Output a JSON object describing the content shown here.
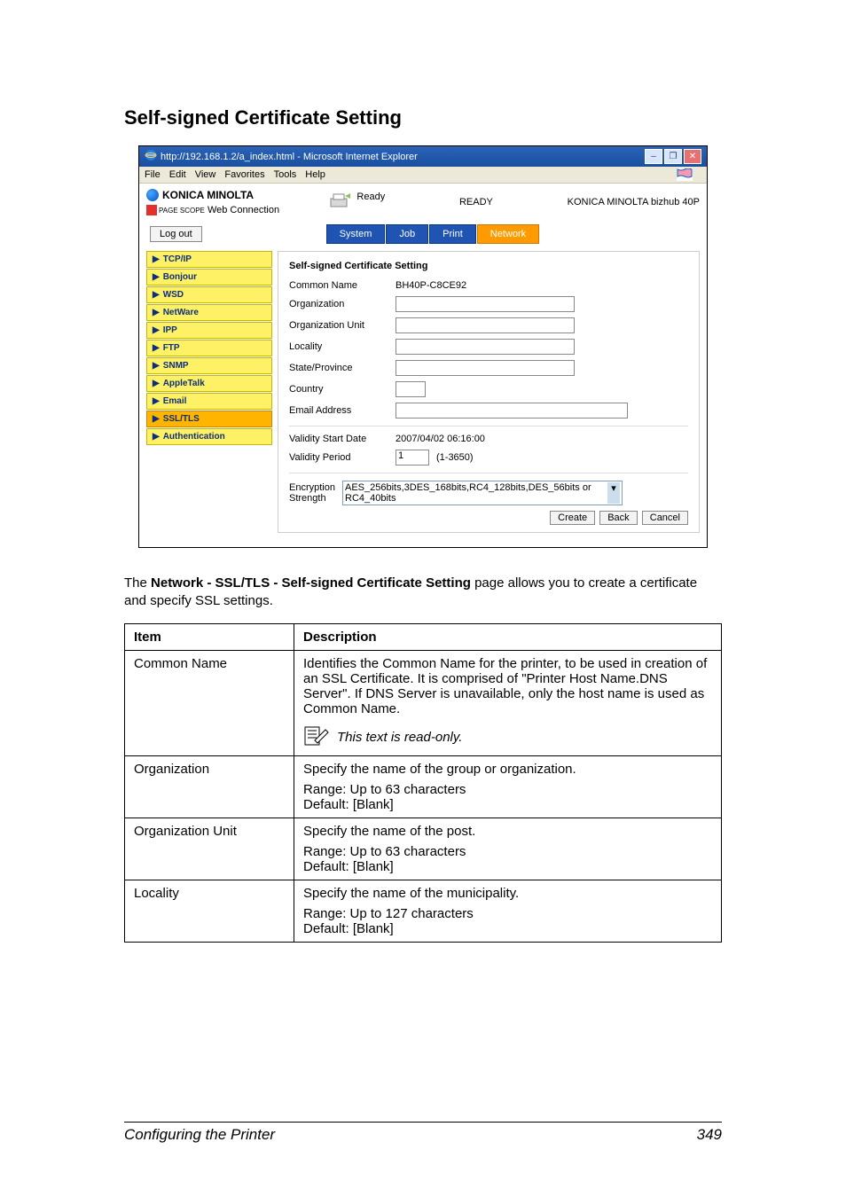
{
  "page": {
    "heading": "Self-signed Certificate Setting",
    "intro_prefix": "The ",
    "intro_bold": "Network - SSL/TLS - Self-signed Certificate Setting",
    "intro_suffix": " page allows you to create a certificate and specify SSL settings.",
    "footer_left": "Configuring the Printer",
    "footer_right": "349"
  },
  "browser": {
    "title": "http://192.168.1.2/a_index.html - Microsoft Internet Explorer",
    "menu": {
      "file": "File",
      "edit": "Edit",
      "view": "View",
      "favorites": "Favorites",
      "tools": "Tools",
      "help": "Help"
    }
  },
  "app": {
    "brand": "KONICA MINOLTA",
    "pagescope": "Web Connection",
    "pagescope_prefix": "PAGE SCOPE",
    "ready_label": "Ready",
    "ready_status": "READY",
    "model": "KONICA MINOLTA bizhub 40P",
    "logout": "Log out",
    "tabs": {
      "system": "System",
      "job": "Job",
      "print": "Print",
      "network": "Network"
    }
  },
  "sidebar": {
    "items": [
      {
        "label": "TCP/IP"
      },
      {
        "label": "Bonjour"
      },
      {
        "label": "WSD"
      },
      {
        "label": "NetWare"
      },
      {
        "label": "IPP"
      },
      {
        "label": "FTP"
      },
      {
        "label": "SNMP"
      },
      {
        "label": "AppleTalk"
      },
      {
        "label": "Email"
      },
      {
        "label": "SSL/TLS"
      },
      {
        "label": "Authentication"
      }
    ],
    "selected_index": 9
  },
  "form": {
    "title": "Self-signed Certificate Setting",
    "common_name_label": "Common Name",
    "common_name_value": "BH40P-C8CE92",
    "organization_label": "Organization",
    "organization_unit_label": "Organization Unit",
    "locality_label": "Locality",
    "state_label": "State/Province",
    "country_label": "Country",
    "email_label": "Email Address",
    "validity_start_label": "Validity Start Date",
    "validity_start_value": "2007/04/02 06:16:00",
    "validity_period_label": "Validity Period",
    "validity_period_value": "1",
    "validity_period_range": "(1-3650)",
    "enc_label": "Encryption Strength",
    "enc_value": "AES_256bits,3DES_168bits,RC4_128bits,DES_56bits or RC4_40bits",
    "btn_create": "Create",
    "btn_back": "Back",
    "btn_cancel": "Cancel"
  },
  "table": {
    "head_item": "Item",
    "head_desc": "Description",
    "rows": [
      {
        "item": "Common Name",
        "desc": "Identifies the Common Name for the printer, to be used in creation of an SSL Certificate. It is comprised of \"Printer Host Name.DNS Server\". If DNS Server is unavailable, only the host name is used as Common Name.",
        "note": "This text is read-only."
      },
      {
        "item": "Organization",
        "desc": "Specify the name of the group or organization.",
        "range": "Range:   Up to 63 characters",
        "def": "Default:  [Blank]"
      },
      {
        "item": "Organization Unit",
        "desc": "Specify the name of the post.",
        "range": "Range:   Up to 63 characters",
        "def": "Default:  [Blank]"
      },
      {
        "item": "Locality",
        "desc": "Specify the name of the municipality.",
        "range": "Range:   Up to 127 characters",
        "def": "Default:  [Blank]"
      }
    ]
  }
}
